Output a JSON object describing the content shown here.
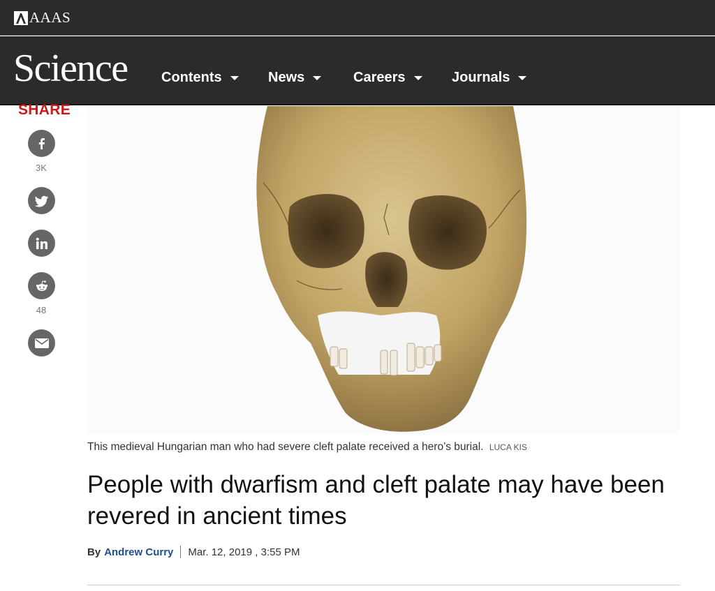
{
  "header": {
    "aaas_label": "AAAS",
    "brand": "Science",
    "nav": [
      {
        "label": "Contents"
      },
      {
        "label": "News"
      },
      {
        "label": "Careers"
      },
      {
        "label": "Journals"
      }
    ]
  },
  "share": {
    "title": "SHARE",
    "buttons": [
      {
        "icon": "facebook-icon",
        "count": "3K"
      },
      {
        "icon": "twitter-icon",
        "count": ""
      },
      {
        "icon": "linkedin-icon",
        "count": ""
      },
      {
        "icon": "reddit-icon",
        "count": "48"
      },
      {
        "icon": "email-icon",
        "count": ""
      }
    ]
  },
  "article": {
    "caption": "This medieval Hungarian man who had severe cleft palate received a hero’s burial.",
    "credit": "LUCA KIS",
    "headline": "People with dwarfism and cleft palate may have been revered in ancient times",
    "by": "By",
    "author": "Andrew Curry",
    "date": "Mar. 12, 2019 , 3:55 PM"
  },
  "colors": {
    "header_bg": "#2b2b2b",
    "share_red": "#cc1a1a",
    "author_blue": "#1f4e8c",
    "icon_gray": "#666666"
  }
}
